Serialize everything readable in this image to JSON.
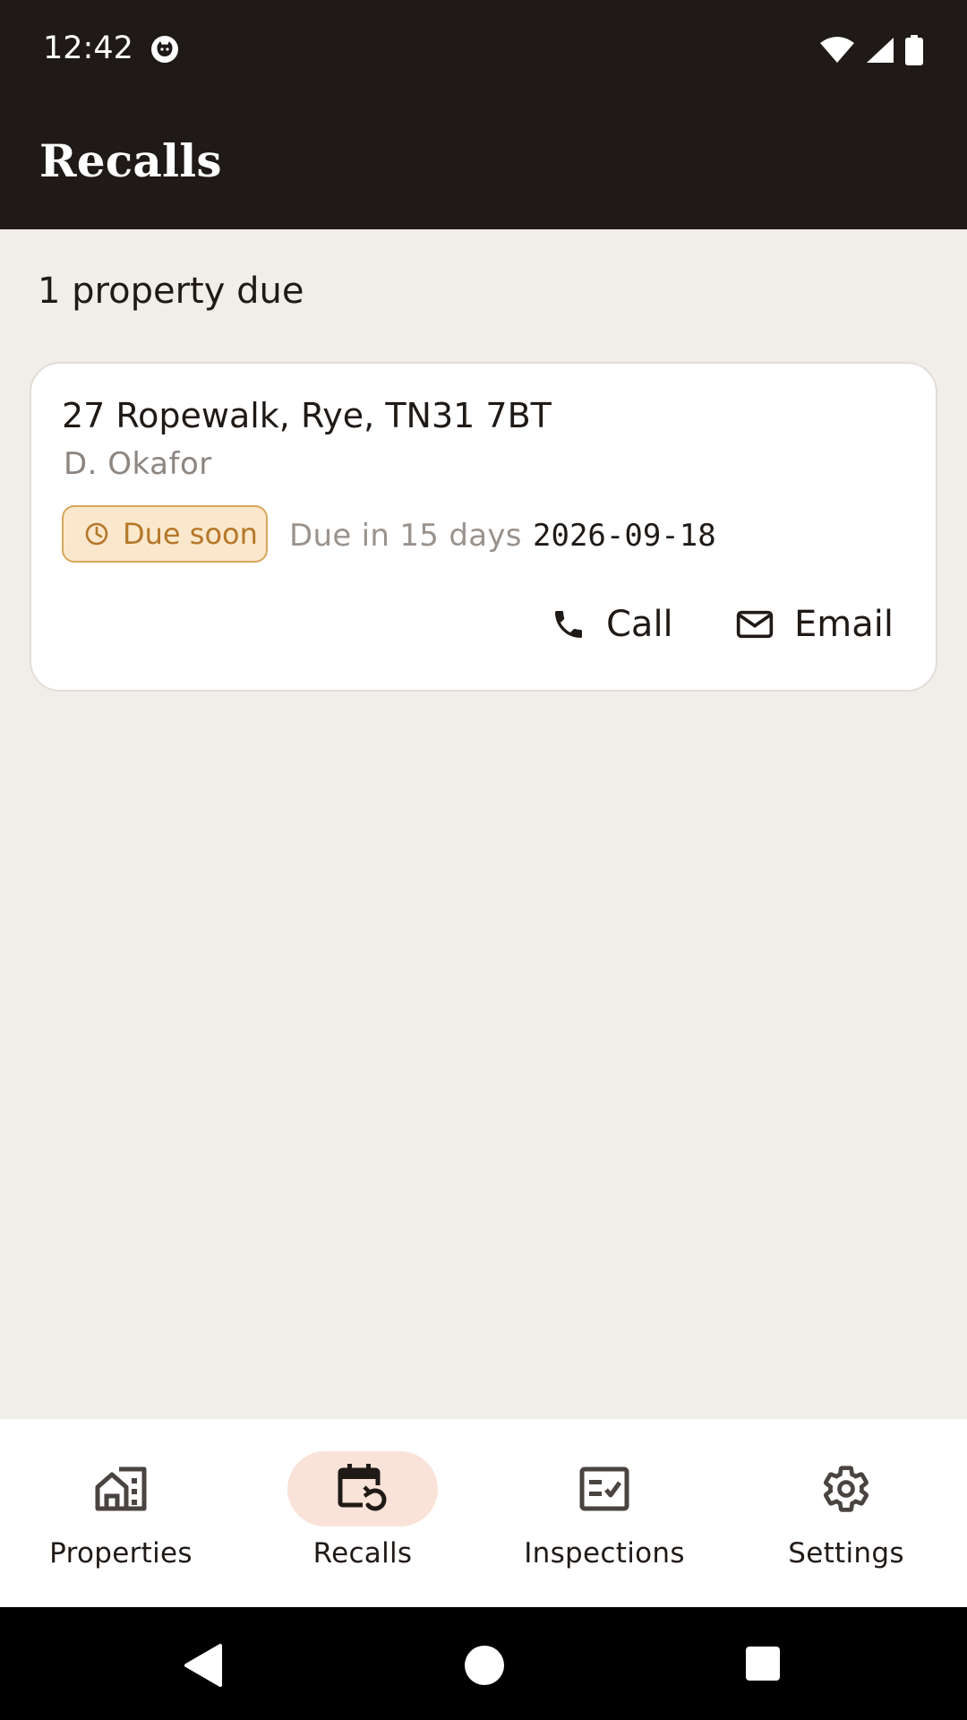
{
  "status_bar": {
    "time": "12:42",
    "icons": [
      "cat-notification-icon",
      "wifi-icon",
      "signal-icon",
      "battery-icon"
    ]
  },
  "app_bar": {
    "title": "Recalls"
  },
  "summary": "1 property due",
  "recalls": [
    {
      "address": "27 Ropewalk, Rye, TN31 7BT",
      "owner": "D. Okafor",
      "badge": "Due soon",
      "badge_icon": "clock-icon",
      "due_text": "Due in 15 days",
      "due_date": "2026-09-18",
      "actions": {
        "call": "Call",
        "email": "Email"
      }
    }
  ],
  "bottom_nav": {
    "active": "recalls",
    "items": [
      {
        "id": "properties",
        "label": "Properties",
        "icon": "home-building-icon"
      },
      {
        "id": "recalls",
        "label": "Recalls",
        "icon": "calendar-refresh-icon"
      },
      {
        "id": "inspections",
        "label": "Inspections",
        "icon": "checklist-icon"
      },
      {
        "id": "settings",
        "label": "Settings",
        "icon": "gear-icon"
      }
    ]
  },
  "colors": {
    "header_bg": "#1f1a17",
    "page_bg": "#f1eeea",
    "badge_bg": "#fbe8cc",
    "badge_border": "#d8a75c",
    "badge_text": "#b5772a",
    "nav_active_pill": "#f9e3d9"
  }
}
